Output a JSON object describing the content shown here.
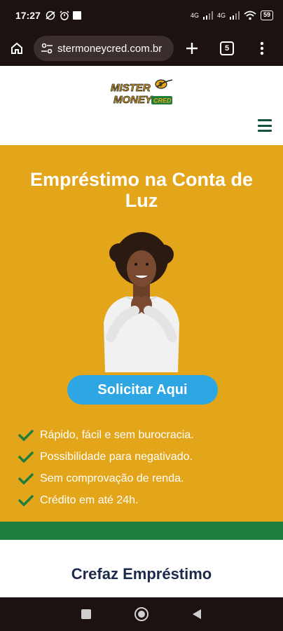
{
  "status_bar": {
    "time": "17:27",
    "network_1": "4G",
    "network_2": "4G",
    "battery": "59"
  },
  "browser": {
    "url": "stermoneycred.com.br",
    "tab_count": "5",
    "icons": [
      "home-icon",
      "site-settings-icon",
      "new-tab-icon",
      "tabs-icon",
      "more-icon"
    ]
  },
  "header": {
    "logo_line1": "MISTER",
    "logo_line2": "MONEY",
    "logo_line3": "CRED"
  },
  "hero": {
    "title": "Empréstimo na Conta de Luz",
    "cta_label": "Solicitar Aqui",
    "features": [
      "Rápido, fácil e sem burocracia.",
      "Possibilidade para negativado.",
      "Sem comprovação de renda.",
      "Crédito em até 24h."
    ]
  },
  "section2": {
    "title": "Crefaz Empréstimo"
  },
  "colors": {
    "hero_bg": "#e3a51a",
    "cta_bg": "#2ea6e3",
    "check": "#1f7e3d",
    "band": "#1f7e3d"
  }
}
